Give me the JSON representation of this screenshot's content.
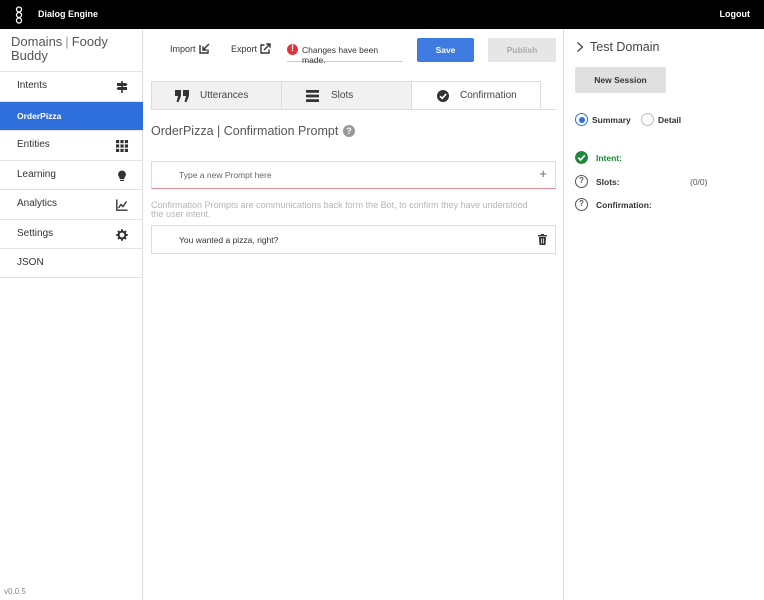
{
  "header": {
    "app_title": "Dialog Engine",
    "logout_label": "Logout"
  },
  "sidebar": {
    "breadcrumb": {
      "domains": "Domains",
      "separator": "|",
      "current": "Foody Buddy"
    },
    "items": [
      {
        "label": "Intents",
        "icon": "signpost-icon"
      },
      {
        "label": "OrderPizza",
        "icon": "",
        "active": true
      },
      {
        "label": "Entities",
        "icon": "grid-icon"
      },
      {
        "label": "Learning",
        "icon": "lightbulb-icon"
      },
      {
        "label": "Analytics",
        "icon": "chart-line-icon"
      },
      {
        "label": "Settings",
        "icon": "gear-icon"
      },
      {
        "label": "JSON",
        "icon": ""
      }
    ],
    "version": "v0.0.5"
  },
  "toolbar": {
    "import_label": "Import",
    "export_label": "Export",
    "changes_message": "Changes have been made.",
    "save_label": "Save",
    "publish_label": "Publish"
  },
  "tabs": [
    {
      "label": "Utterances",
      "icon": "quote-icon"
    },
    {
      "label": "Slots",
      "icon": "list-icon"
    },
    {
      "label": "Confirmation",
      "icon": "check-circle-icon",
      "active": true
    }
  ],
  "main": {
    "title": "OrderPizza | Confirmation Prompt",
    "prompt_placeholder": "Type a new Prompt here",
    "description": "Confirmation Prompts are communications back form the Bot, to confirm they have understood the user intent.",
    "prompts": [
      "You wanted a pizza, right?"
    ]
  },
  "test_panel": {
    "title": "Test Domain",
    "new_session_label": "New Session",
    "view_options": [
      "Summary",
      "Detail"
    ],
    "selected_view": "Summary",
    "status": [
      {
        "label": "Intent:",
        "value": "",
        "state": "ok"
      },
      {
        "label": "Slots:",
        "value": "(0/0)",
        "state": "unknown"
      },
      {
        "label": "Confirmation:",
        "value": "",
        "state": "unknown"
      }
    ]
  },
  "colors": {
    "accent": "#2f6fdb",
    "save": "#3d7be0",
    "alert": "#e2343e",
    "success": "#1c8a3a"
  }
}
